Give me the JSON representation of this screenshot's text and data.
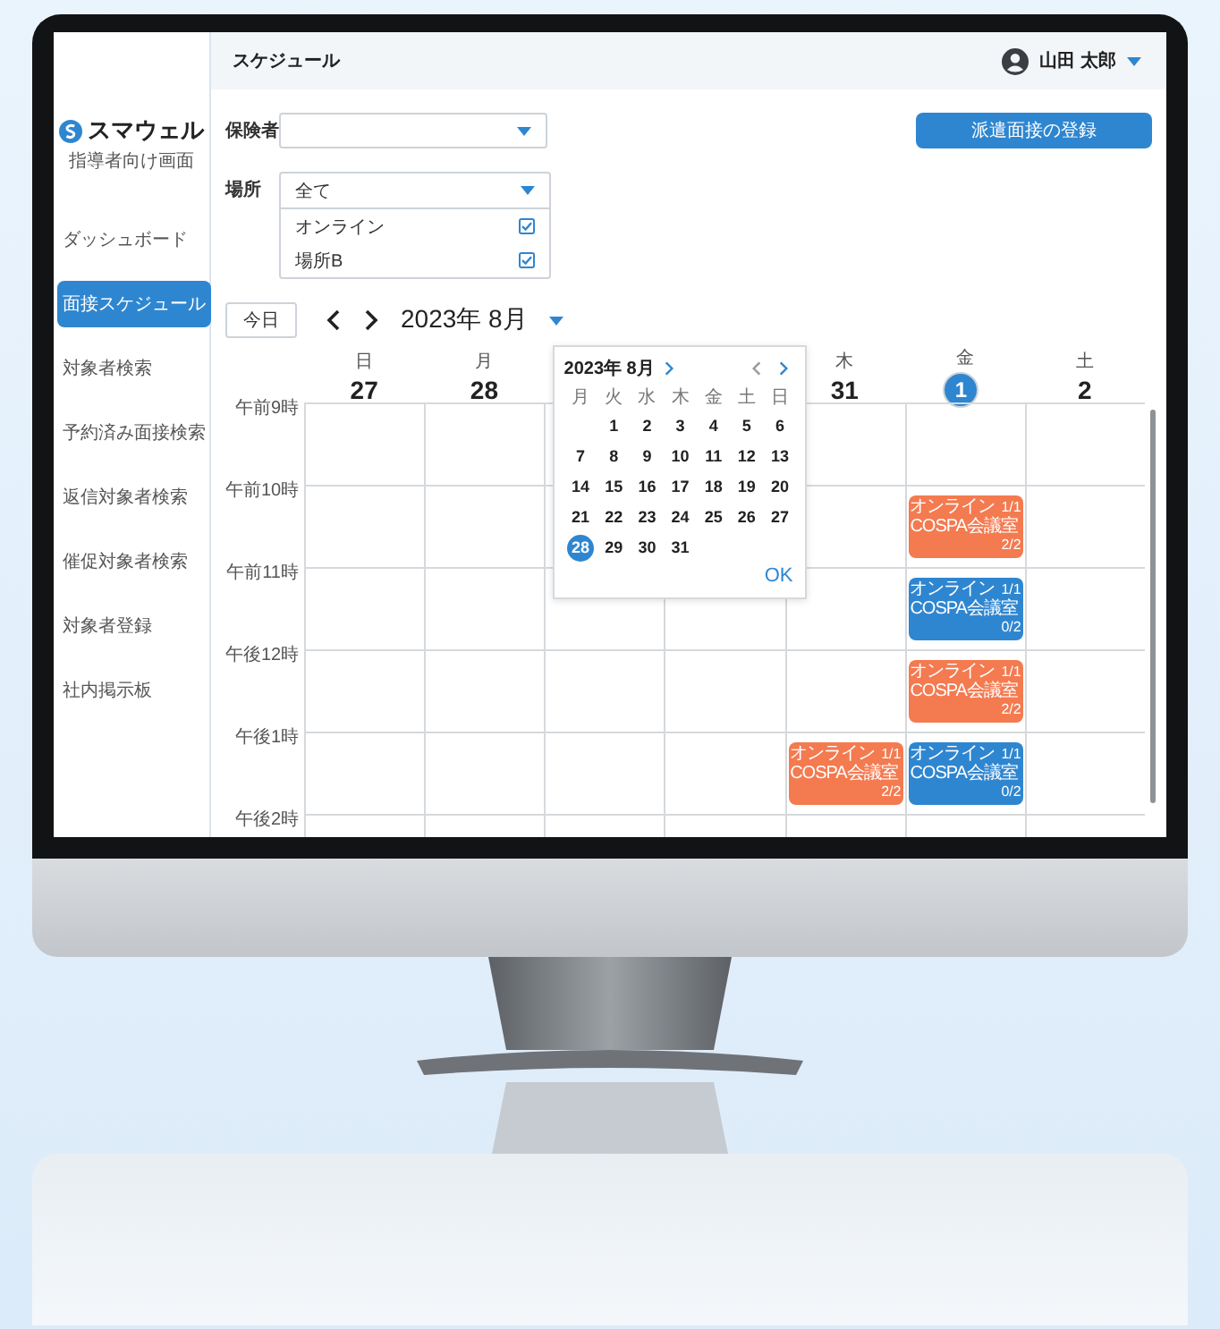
{
  "header": {
    "title": "スケジュール",
    "user_name": "山田 太郎"
  },
  "sidebar": {
    "logo": "スマウェル",
    "subtitle": "指導者向け画面",
    "items": [
      {
        "label": "ダッシュボード",
        "selected": false
      },
      {
        "label": "面接スケジュール",
        "selected": true
      },
      {
        "label": "対象者検索",
        "selected": false
      },
      {
        "label": "予約済み面接検索",
        "selected": false
      },
      {
        "label": "返信対象者検索",
        "selected": false
      },
      {
        "label": "催促対象者検索",
        "selected": false
      },
      {
        "label": "対象者登録",
        "selected": false
      },
      {
        "label": "社内掲示板",
        "selected": false
      }
    ]
  },
  "filters": {
    "insurer": {
      "label": "保険者"
    },
    "place": {
      "label": "場所",
      "value": "全て",
      "expanded": true,
      "options": [
        {
          "label": "オンライン",
          "checked": true
        },
        {
          "label": "場所B",
          "checked": true
        }
      ]
    }
  },
  "register_button": "派遣面接の登録",
  "toolbar": {
    "today": "今日",
    "month": "2023年 8月"
  },
  "days": [
    {
      "kind": "day",
      "weekday": "日",
      "date": "27",
      "today": false
    },
    {
      "kind": "day",
      "weekday": "月",
      "date": "28",
      "today": false
    },
    {
      "kind": "covered"
    },
    {
      "kind": "covered"
    },
    {
      "kind": "day",
      "weekday": "木",
      "date": "31",
      "today": false
    },
    {
      "kind": "day",
      "weekday": "金",
      "date": "1",
      "today": true
    },
    {
      "kind": "day",
      "weekday": "土",
      "date": "2",
      "today": false
    }
  ],
  "time_rows": [
    {
      "label": "午前9時"
    },
    {
      "label": "午前10時",
      "cells": [
        {
          "kind": "empty"
        },
        {
          "kind": "empty"
        },
        {
          "kind": "empty"
        },
        {
          "kind": "empty"
        },
        {
          "kind": "empty"
        },
        {
          "kind": "event",
          "color": "#f47a50",
          "title": "オンライン",
          "title_count": "1/1",
          "room": "COSPA会議室",
          "room_count": "2/2"
        },
        {
          "kind": "empty"
        }
      ]
    },
    {
      "label": "午前11時",
      "cells": [
        {
          "kind": "empty"
        },
        {
          "kind": "empty"
        },
        {
          "kind": "empty"
        },
        {
          "kind": "empty"
        },
        {
          "kind": "empty"
        },
        {
          "kind": "event",
          "color": "#2f86d0",
          "title": "オンライン",
          "title_count": "1/1",
          "room": "COSPA会議室",
          "room_count": "0/2"
        },
        {
          "kind": "empty"
        }
      ]
    },
    {
      "label": "午後12時",
      "cells": [
        {
          "kind": "empty"
        },
        {
          "kind": "empty"
        },
        {
          "kind": "empty"
        },
        {
          "kind": "empty"
        },
        {
          "kind": "empty"
        },
        {
          "kind": "event",
          "color": "#f47a50",
          "title": "オンライン",
          "title_count": "1/1",
          "room": "COSPA会議室",
          "room_count": "2/2"
        },
        {
          "kind": "empty"
        }
      ]
    },
    {
      "label": "午後1時",
      "cells": [
        {
          "kind": "empty"
        },
        {
          "kind": "empty"
        },
        {
          "kind": "empty"
        },
        {
          "kind": "empty"
        },
        {
          "kind": "event",
          "color": "#f47a50",
          "title": "オンライン",
          "title_count": "1/1",
          "room": "COSPA会議室",
          "room_count": "2/2"
        },
        {
          "kind": "event",
          "color": "#2f86d0",
          "title": "オンライン",
          "title_count": "1/1",
          "room": "COSPA会議室",
          "room_count": "0/2"
        },
        {
          "kind": "empty"
        }
      ]
    },
    {
      "label": "午後2時"
    }
  ],
  "date_picker": {
    "title": "2023年 8月",
    "weekdays": [
      "月",
      "火",
      "水",
      "木",
      "金",
      "土",
      "日"
    ],
    "weeks": [
      [
        {
          "label": "1",
          "selected": false
        },
        {
          "label": "2",
          "selected": false
        },
        {
          "label": "3",
          "selected": false
        },
        {
          "label": "4",
          "selected": false
        },
        {
          "label": "5",
          "selected": false
        },
        {
          "label": "6",
          "selected": false
        }
      ],
      [
        {
          "label": "7",
          "selected": false
        },
        {
          "label": "8",
          "selected": false
        },
        {
          "label": "9",
          "selected": false
        },
        {
          "label": "10",
          "selected": false
        },
        {
          "label": "11",
          "selected": false
        },
        {
          "label": "12",
          "selected": false
        },
        {
          "label": "13",
          "selected": false
        }
      ],
      [
        {
          "label": "14",
          "selected": false
        },
        {
          "label": "15",
          "selected": false
        },
        {
          "label": "16",
          "selected": false
        },
        {
          "label": "17",
          "selected": false
        },
        {
          "label": "18",
          "selected": false
        },
        {
          "label": "19",
          "selected": false
        },
        {
          "label": "20",
          "selected": false
        }
      ],
      [
        {
          "label": "21",
          "selected": false
        },
        {
          "label": "22",
          "selected": false
        },
        {
          "label": "23",
          "selected": false
        },
        {
          "label": "24",
          "selected": false
        },
        {
          "label": "25",
          "selected": false
        },
        {
          "label": "26",
          "selected": false
        },
        {
          "label": "27",
          "selected": false
        }
      ],
      [
        {
          "label": "28",
          "selected": true
        },
        {
          "label": "29",
          "selected": false
        },
        {
          "label": "30",
          "selected": false
        },
        {
          "label": "31",
          "selected": false
        }
      ]
    ],
    "ok": "OK"
  }
}
